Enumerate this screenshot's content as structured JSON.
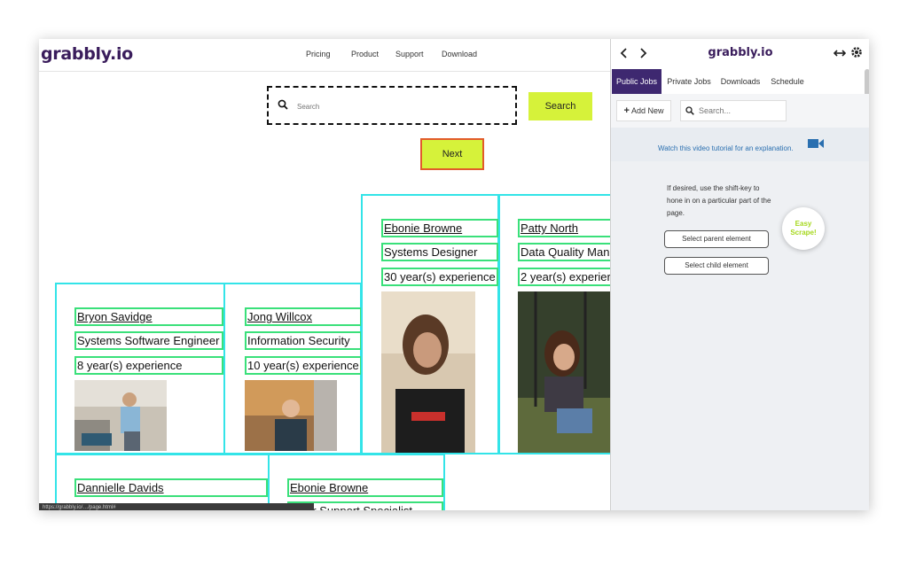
{
  "site": {
    "logo": "grabbly.io",
    "nav": [
      "Pricing",
      "Product",
      "Support",
      "Download"
    ],
    "search_placeholder": "Search",
    "search_button": "Search",
    "next_button": "Next",
    "cards": [
      {
        "name": "Bryon Savidge",
        "title": "Systems Software Engineer",
        "experience": "8 year(s) experience"
      },
      {
        "name": "Jong Willcox",
        "title": "Information Security",
        "experience": "10 year(s) experience"
      },
      {
        "name": "Ebonie Browne",
        "title": "Systems Designer",
        "experience": "30 year(s) experience"
      },
      {
        "name": "Patty North",
        "title": "Data Quality Man",
        "experience": "2 year(s) experier"
      },
      {
        "name": "Dannielle Davids"
      },
      {
        "name": "Ebonie Browne",
        "title": "omer Support Specialist"
      }
    ],
    "status_url": "https://grabbly.io/…/page.html#"
  },
  "panel": {
    "title": "grabbly.io",
    "tabs": [
      "Public Jobs",
      "Private Jobs",
      "Downloads",
      "Schedule"
    ],
    "add_new": "Add New",
    "search_placeholder": "Search...",
    "tutorial": "Watch this video tutorial for an explanation.",
    "hint": "If desired, use the shift-key to hone in on a particular part of the page.",
    "select_parent": "Select parent element",
    "select_child": "Select child element",
    "easy_scrape_1": "Easy",
    "easy_scrape_2": "Scrape!"
  },
  "colors": {
    "accent": "#d6f23a",
    "brand": "#3a1d5c",
    "tab_active": "#3e2870",
    "card_border": "#33e4e8",
    "field_border": "#3ae07a"
  }
}
